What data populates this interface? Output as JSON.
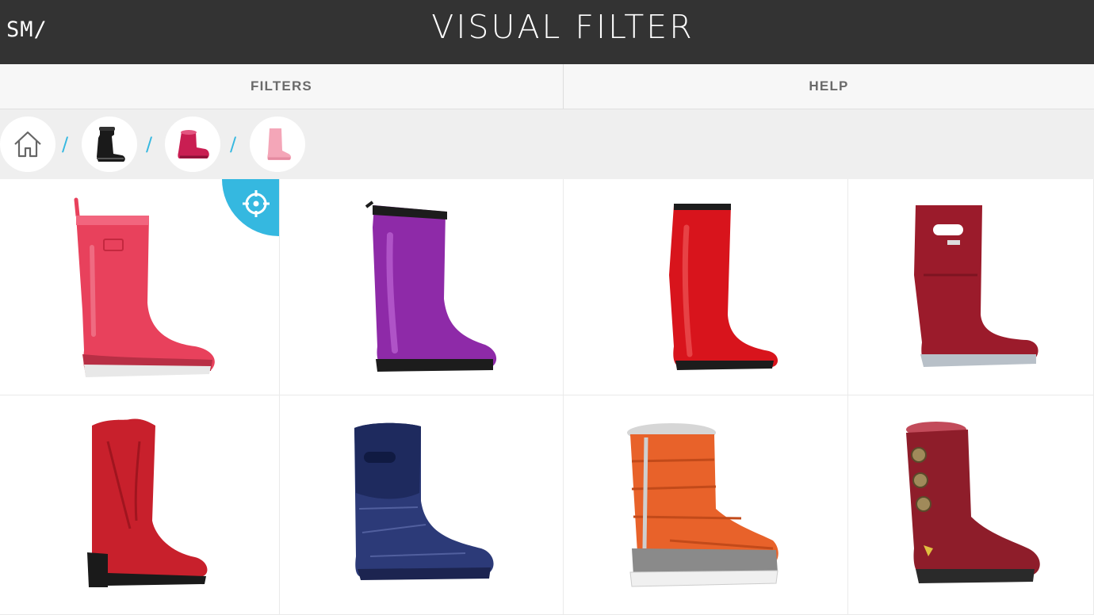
{
  "header": {
    "logo": "SM/",
    "title": "VISUAL FILTER"
  },
  "tabs": [
    {
      "label": "FILTERS"
    },
    {
      "label": "HELP"
    }
  ],
  "breadcrumb": {
    "separator": "/",
    "items": [
      {
        "icon": "home-icon"
      },
      {
        "icon": "black-snow-boot-thumbnail"
      },
      {
        "icon": "pink-sheepskin-boot-thumbnail"
      },
      {
        "icon": "light-pink-rain-boot-thumbnail"
      }
    ]
  },
  "colors": {
    "header_bg": "#333333",
    "accent": "#35b8e0"
  },
  "products": [
    {
      "icon": "pink-rain-boot",
      "color": "#e8415c"
    },
    {
      "icon": "purple-rain-boot",
      "color": "#8e2aa8"
    },
    {
      "icon": "red-rain-boot",
      "color": "#d8141c"
    },
    {
      "icon": "burgundy-rain-boot",
      "color": "#9b1b2b"
    },
    {
      "icon": "red-cowboy-boot",
      "color": "#c8202c"
    },
    {
      "icon": "navy-neoprene-boot",
      "color": "#2c3a78"
    },
    {
      "icon": "orange-puffer-boot",
      "color": "#e8622a"
    },
    {
      "icon": "burgundy-suede-button-boot",
      "color": "#8e1d2a"
    }
  ]
}
